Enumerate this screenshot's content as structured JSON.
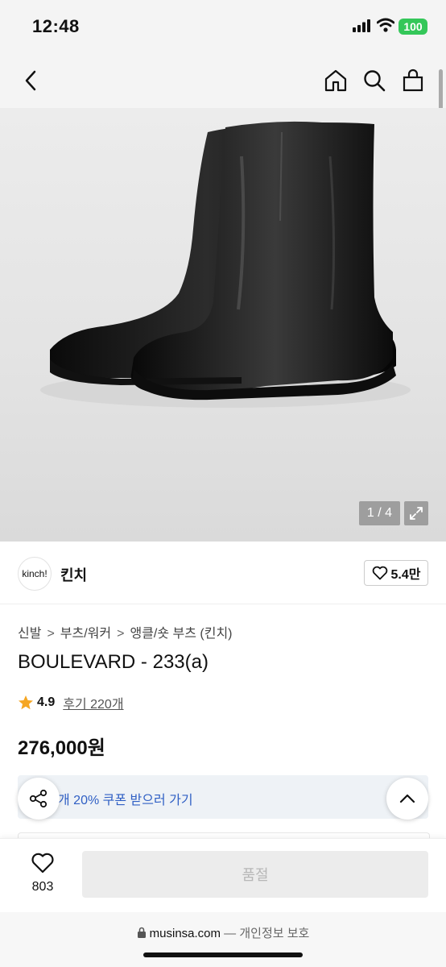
{
  "status": {
    "time": "12:48",
    "battery": "100"
  },
  "nav": {
    "back": "back-icon",
    "home": "home-icon",
    "search": "search-icon",
    "bag": "bag-icon"
  },
  "gallery": {
    "pager": "1 / 4"
  },
  "brand": {
    "logo_text": "kinch!",
    "name": "킨치",
    "likes": "5.4만"
  },
  "breadcrumb": [
    "신발",
    "부츠/워커",
    "앵클/숏 부츠 (킨치)"
  ],
  "product": {
    "title": "BOULEVARD - 233(a)",
    "rating": "4.9",
    "reviews": "후기 220개",
    "price": "276,000원",
    "coupon": "개 20% 쿠폰 받으러 가기"
  },
  "bottom": {
    "likes_count": "803",
    "buy_label": "품절"
  },
  "browser": {
    "domain": "musinsa.com",
    "privacy": " — 개인정보 보호"
  },
  "colors": {
    "coupon_text": "#2f5fc4",
    "battery": "#34c759",
    "star": "#f5a623"
  }
}
